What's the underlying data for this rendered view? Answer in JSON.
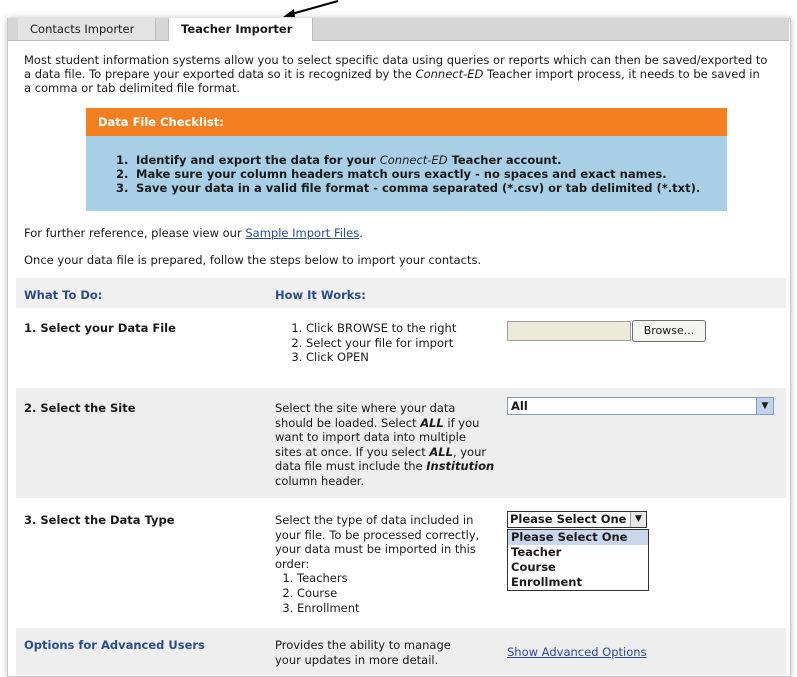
{
  "tabs": [
    {
      "label": "Contacts Importer",
      "active": false
    },
    {
      "label": "Teacher Importer",
      "active": true
    }
  ],
  "intro": {
    "part1": "Most student information systems allow you to select specific data using queries or reports which can then be saved/exported to a data file. To prepare your exported data so it is recognized by the ",
    "brand": "Connect-ED",
    "part2": " Teacher import process, it needs to be saved in a comma or tab delimited file format."
  },
  "checklist": {
    "title": "Data File Checklist:",
    "items": [
      {
        "num": "1.",
        "pre": "Identify and export the data for your ",
        "brand": "Connect-ED",
        "post": " Teacher account."
      },
      {
        "num": "2.",
        "text": "Make sure your column headers match ours exactly - no spaces and exact names."
      },
      {
        "num": "3.",
        "text": "Save your data in a valid file format - comma separated (*.csv) or tab delimited (*.txt)."
      }
    ]
  },
  "reference": {
    "text": "For further reference, please view our ",
    "link": "Sample Import Files",
    "end": "."
  },
  "prepared_text": "Once your data file is prepared, follow the steps below to import your contacts.",
  "headers": {
    "what": "What To Do:",
    "how": "How It Works:"
  },
  "step1": {
    "title": "1. Select your Data File",
    "steps": [
      "Click BROWSE to the right",
      "Select your file for import",
      "Click OPEN"
    ],
    "browse_label": "Browse..."
  },
  "step2": {
    "title": "2. Select the Site",
    "desc_a": "Select the site where your data should be loaded. Select ",
    "all1": "ALL",
    "desc_b": " if you want to import data into multiple sites at once. If you select ",
    "all2": "ALL",
    "desc_c": ", your data file must include the ",
    "institution": "Institution",
    "desc_d": " column header.",
    "selected": "All"
  },
  "step3": {
    "title": "3. Select the Data Type",
    "desc": "Select the type of data included in your file. To be processed correctly, your data must be imported in this order:",
    "order": [
      "Teachers",
      "Course",
      "Enrollment"
    ],
    "selected": "Please Select One",
    "options": [
      "Please Select One",
      "Teacher",
      "Course",
      "Enrollment"
    ]
  },
  "advanced": {
    "title": "Options for Advanced Users",
    "desc": "Provides the ability to manage your updates in more detail.",
    "link": "Show Advanced Options"
  },
  "colors": {
    "orange": "#f47f20",
    "blue_panel": "#a9cfe7",
    "link": "#2a4a9a",
    "header_blue": "#2b4d86"
  }
}
